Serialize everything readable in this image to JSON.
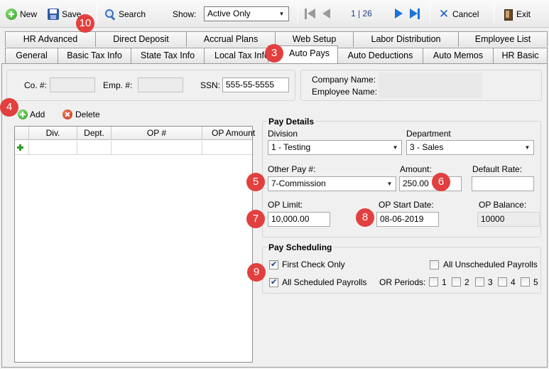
{
  "toolbar": {
    "new_label": "New",
    "save_label": "Save",
    "search_label": "Search",
    "show_label": "Show:",
    "show_value": "Active Only",
    "record_position": "1 | 26",
    "cancel_label": "Cancel",
    "exit_label": "Exit"
  },
  "tabs": {
    "row1": [
      "HR Advanced",
      "Direct Deposit",
      "Accrual Plans",
      "Web Setup",
      "Labor Distribution",
      "Employee List"
    ],
    "row2": [
      "General",
      "Basic Tax Info",
      "State Tax Info",
      "Local Tax Info",
      "Auto Pays",
      "Auto Deductions",
      "Auto Memos",
      "HR Basic"
    ],
    "active": "Auto Pays"
  },
  "header": {
    "co_label": "Co. #:",
    "co_value": "",
    "emp_label": "Emp. #:",
    "emp_value": "",
    "ssn_label": "SSN:",
    "ssn_value": "555-55-5555",
    "company_name_label": "Company Name:",
    "employee_name_label": "Employee Name:"
  },
  "grid": {
    "add_label": "Add",
    "delete_label": "Delete",
    "columns": [
      "",
      "Div.",
      "Dept.",
      "OP #",
      "OP Amount"
    ]
  },
  "pay_details": {
    "title": "Pay Details",
    "division_label": "Division",
    "division_value": "1 - Testing",
    "department_label": "Department",
    "department_value": "3 - Sales",
    "other_pay_label": "Other Pay #:",
    "other_pay_value": "7-Commission",
    "amount_label": "Amount:",
    "amount_value": "250.00",
    "default_rate_label": "Default Rate:",
    "default_rate_value": "",
    "op_limit_label": "OP Limit:",
    "op_limit_value": "10,000.00",
    "op_start_label": "OP Start Date:",
    "op_start_value": "08-06-2019",
    "op_balance_label": "OP Balance:",
    "op_balance_value": "10000"
  },
  "pay_scheduling": {
    "title": "Pay Scheduling",
    "first_check_label": "First Check Only",
    "first_check_checked": true,
    "all_scheduled_label": "All Scheduled Payrolls",
    "all_scheduled_checked": true,
    "all_unscheduled_label": "All Unscheduled Payrolls",
    "all_unscheduled_checked": false,
    "or_periods_label": "OR Periods:",
    "periods": [
      "1",
      "2",
      "3",
      "4",
      "5"
    ]
  },
  "callouts": [
    "10",
    "3",
    "4",
    "5",
    "6",
    "7",
    "8",
    "9"
  ],
  "colors": {
    "callout": "#e23f3f",
    "accent": "#1a73d9"
  }
}
